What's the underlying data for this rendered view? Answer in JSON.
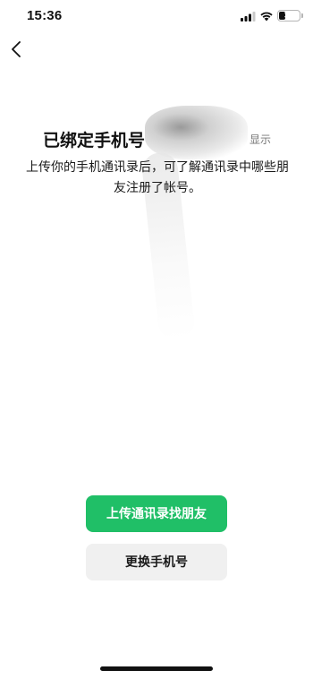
{
  "status_bar": {
    "time": "15:36",
    "battery_level": "31",
    "battery_percent": 31,
    "icons": [
      "signal-icon",
      "wifi-icon",
      "battery-icon"
    ]
  },
  "nav": {
    "back_icon": "chevron-left-icon"
  },
  "content": {
    "title": "已绑定手机号",
    "title_hint": "显示",
    "description": "上传你的手机通讯录后，可了解通讯录中哪些朋友注册了帐号。"
  },
  "actions": {
    "upload_contacts_label": "上传通讯录找朋友",
    "change_phone_label": "更换手机号"
  },
  "colors": {
    "primary": "#20bf67",
    "secondary_bg": "#f0f0f0",
    "text": "#111111"
  }
}
